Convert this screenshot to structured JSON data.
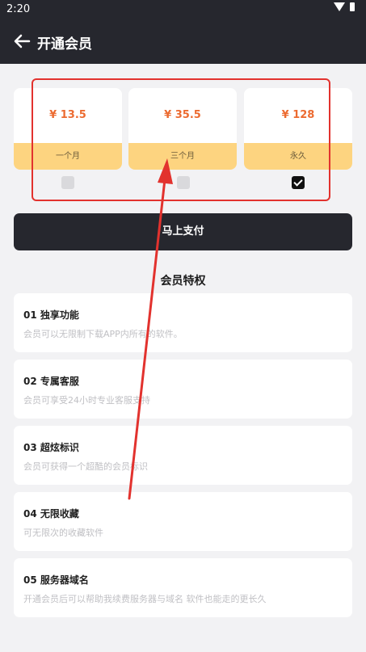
{
  "status": {
    "time": "2:20"
  },
  "header": {
    "title": "开通会员"
  },
  "plans": [
    {
      "price": "¥ 13.5",
      "name": "一个月",
      "checked": false
    },
    {
      "price": "¥ 35.5",
      "name": "三个月",
      "checked": false
    },
    {
      "price": "¥ 128",
      "name": "永久",
      "checked": true
    }
  ],
  "pay": {
    "label": "马上支付"
  },
  "benefits": {
    "title": "会员特权",
    "items": [
      {
        "title": "01 独享功能",
        "desc": "会员可以无限制下载APP内所有的软件。"
      },
      {
        "title": "02 专属客服",
        "desc": "会员可享受24小时专业客服支持"
      },
      {
        "title": "03 超炫标识",
        "desc": "会员可获得一个超酷的会员标识"
      },
      {
        "title": "04 无限收藏",
        "desc": "可无限次的收藏软件"
      },
      {
        "title": "05 服务器域名",
        "desc": "开通会员后可以帮助我续费服务器与域名 软件也能走的更长久"
      }
    ]
  },
  "colors": {
    "dark": "#26272e",
    "accent": "#ec6b31",
    "gold": "#fdd480",
    "annotation": "#e2322e"
  }
}
